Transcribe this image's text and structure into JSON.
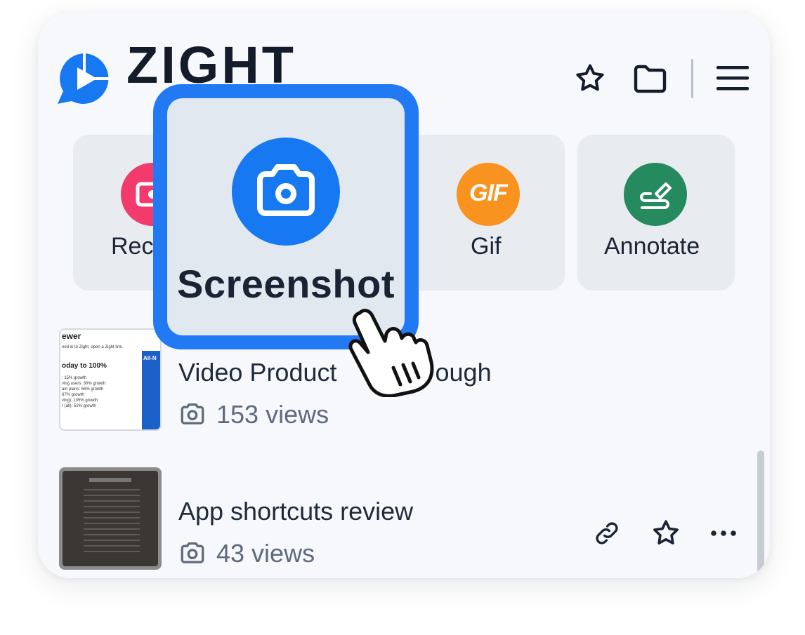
{
  "header": {
    "brand": "ZIGHT",
    "icons": [
      "zight-logo-icon",
      "star-icon",
      "folder-icon",
      "menu-icon"
    ]
  },
  "tiles": [
    {
      "label": "Rec",
      "icon": "record-icon",
      "color": "#f23a6d"
    },
    {
      "label": "Screenshot",
      "icon": "camera-icon",
      "color": "#1679f2"
    },
    {
      "label": "Gif",
      "icon": "gif-icon",
      "icon_text": "GIF",
      "color": "#f7931e"
    },
    {
      "label": "Annotate",
      "icon": "annotate-icon",
      "color": "#258a5e"
    }
  ],
  "popup": {
    "label": "Screenshot",
    "icon": "camera-icon"
  },
  "list": [
    {
      "title": "Video Product",
      "title_tail": "ough",
      "views": "153 views",
      "icon": "camera-icon"
    },
    {
      "title": "App shortcuts review",
      "views": "43 views",
      "icon": "camera-icon"
    }
  ],
  "thumbnail_text": {
    "heading": "ewer",
    "line1": "ned in to Zight, open a Zight link.",
    "subheading": "oday to 100%",
    "bullets": [
      ": 15% growth",
      "ving users: 30% growth",
      "am plans: 56% growth",
      "67% growth",
      "ving): 135% growth",
      "r (all): 52% growth"
    ],
    "overlay": "All-N"
  },
  "row_actions": [
    "link-icon",
    "star-icon",
    "more-icon"
  ],
  "colors": {
    "accent": "#1679f2",
    "panel_bg": "#f6f8fb",
    "tile_bg": "#e8ebef"
  }
}
